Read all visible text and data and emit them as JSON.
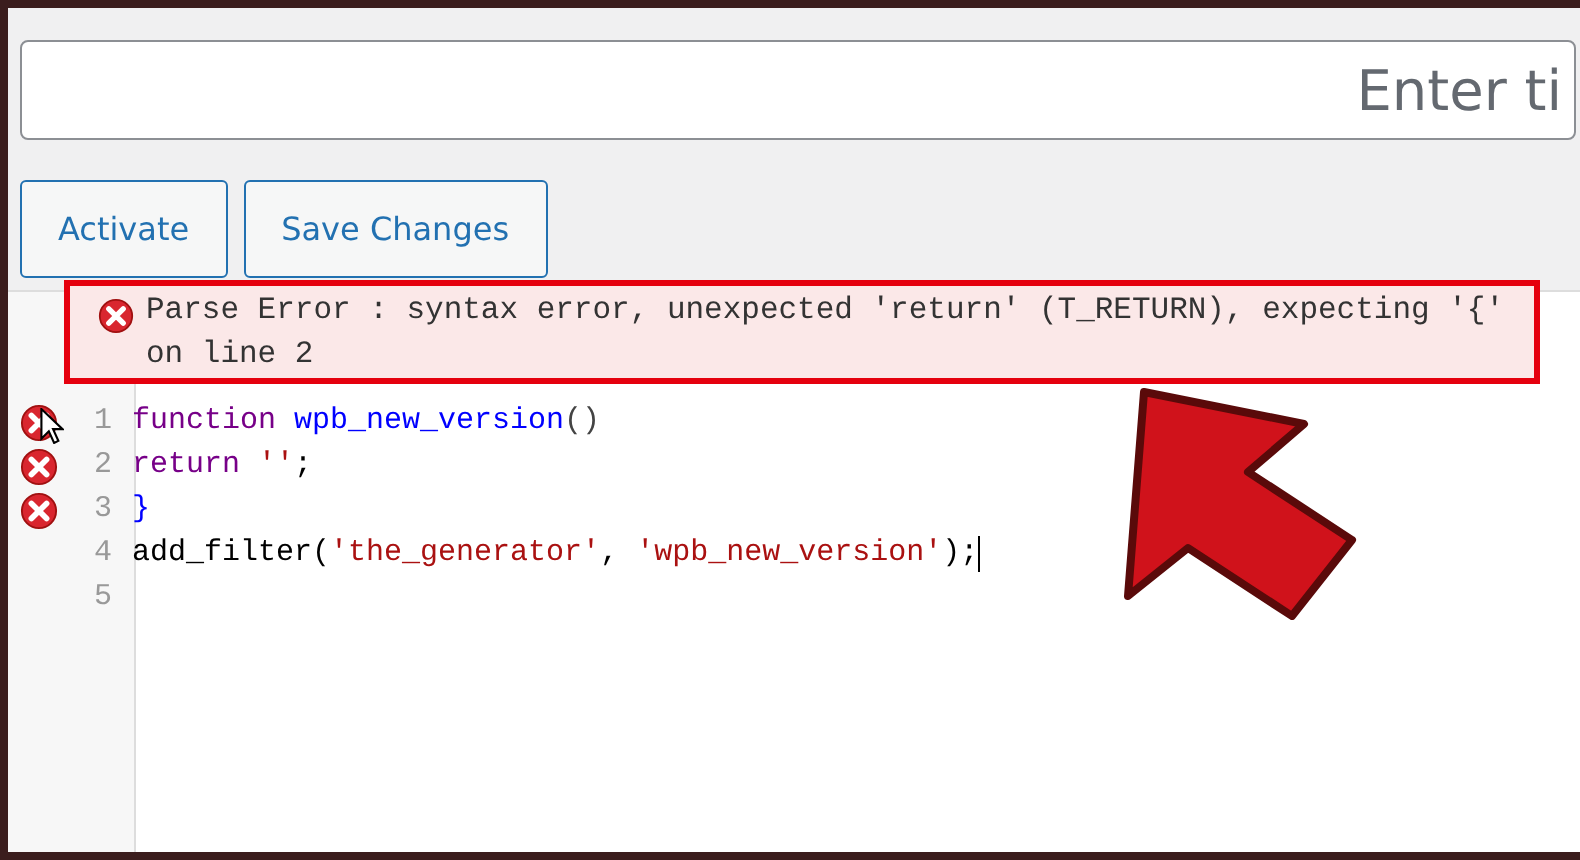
{
  "title_field": {
    "placeholder": "Enter ti"
  },
  "buttons": [
    {
      "label": "Activate"
    },
    {
      "label": "Save Changes"
    }
  ],
  "error_tooltip": {
    "text": "Parse Error : syntax error, unexpected 'return' (T_RETURN), expecting '{' on line 2"
  },
  "editor": {
    "lines": [
      {
        "number": "1",
        "error": true,
        "tokens": [
          {
            "kind": "keyword",
            "text": "function "
          },
          {
            "kind": "def",
            "text": "wpb_new_version"
          },
          {
            "kind": "bracket",
            "text": "()"
          }
        ]
      },
      {
        "number": "2",
        "error": true,
        "tokens": [
          {
            "kind": "keyword",
            "text": "return "
          },
          {
            "kind": "string",
            "text": "''"
          },
          {
            "kind": "plain",
            "text": ";"
          }
        ]
      },
      {
        "number": "3",
        "error": true,
        "tokens": [
          {
            "kind": "def",
            "text": "}"
          }
        ]
      },
      {
        "number": "4",
        "error": false,
        "cursor": true,
        "tokens": [
          {
            "kind": "plain",
            "text": "add_filter("
          },
          {
            "kind": "string",
            "text": "'the_generator'"
          },
          {
            "kind": "plain",
            "text": ", "
          },
          {
            "kind": "string",
            "text": "'wpb_new_version'"
          },
          {
            "kind": "plain",
            "text": ");"
          }
        ]
      },
      {
        "number": "5",
        "error": false
      }
    ]
  },
  "annotation": {
    "kind": "arrow"
  }
}
